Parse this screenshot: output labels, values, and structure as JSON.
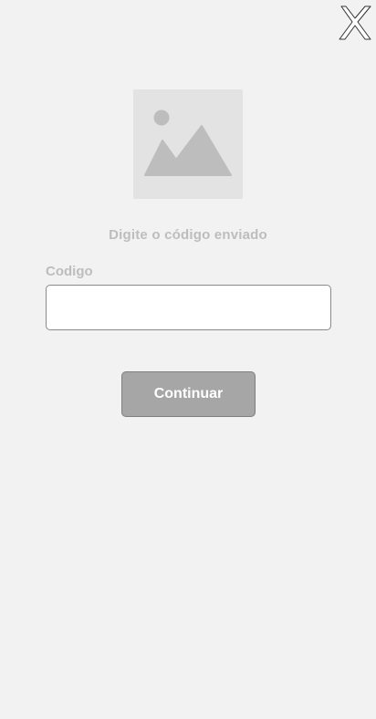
{
  "header": {
    "close_icon": "close-icon"
  },
  "hero": {
    "icon": "image-placeholder-icon"
  },
  "form": {
    "subtitle": "Digite o código enviado",
    "code_label": "Codigo",
    "code_value": "",
    "code_placeholder": ""
  },
  "actions": {
    "continue_label": "Continuar"
  },
  "colors": {
    "background": "#f2f2f2",
    "muted_text": "#bdbdbd",
    "button_bg": "#a6a6a6",
    "button_text": "#ffffff",
    "placeholder_bg": "#e3e3e3",
    "placeholder_fg": "#bdbdbd"
  }
}
